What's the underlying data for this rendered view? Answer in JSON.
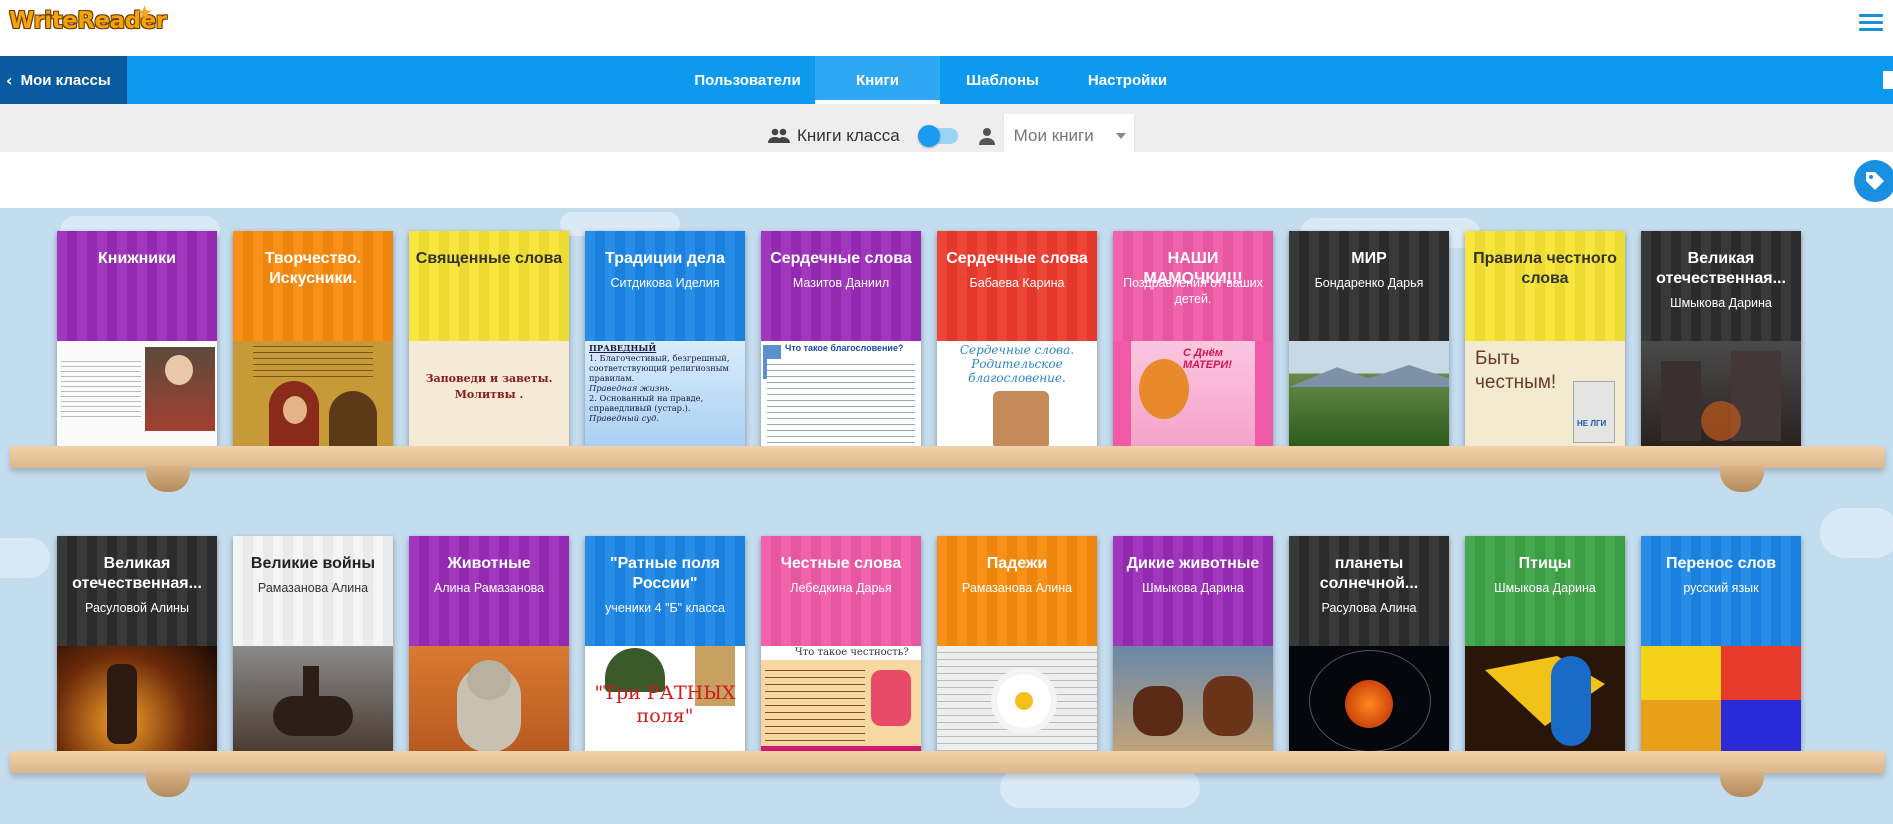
{
  "app": {
    "logo": "WriteReader",
    "logo_star": "★"
  },
  "nav": {
    "back_label": "Мои классы",
    "tabs": [
      {
        "label": "Пользователи",
        "active": false
      },
      {
        "label": "Книги",
        "active": true
      },
      {
        "label": "Шаблоны",
        "active": false
      },
      {
        "label": "Настройки",
        "active": false
      }
    ]
  },
  "filters": {
    "class_books_label": "Книги класса",
    "toggle_on": false,
    "my_books_select": "Мои книги"
  },
  "colors": {
    "nav_blue": "#0d9aee",
    "back_blue": "#0a5aa0",
    "accent": "#1a8fe0"
  },
  "shelves": [
    {
      "books": [
        {
          "title": "Книжники",
          "author": "",
          "color": "#9a2bb8",
          "pic": "portrait-page"
        },
        {
          "title": "Творчество. Искусники.",
          "author": "",
          "color": "#f88a0c",
          "pic": "icon-painting"
        },
        {
          "title": "Священные слова",
          "author": "",
          "color": "#f6e533",
          "pic": "parchment-text",
          "style": "yellow"
        },
        {
          "title": "Традиции дела",
          "author": "Ситдикова Иделия",
          "color": "#1a86e6",
          "pic": "text-sky"
        },
        {
          "title": "Сердечные слова",
          "author": "Мазитов Даниил",
          "color": "#9a2bb8",
          "pic": "text-list"
        },
        {
          "title": "Сердечные слова",
          "author": "Бабаева Карина",
          "color": "#ec3a2d",
          "pic": "family-photo"
        },
        {
          "title": "НАШИ МАМОЧКИ!!!",
          "author": "Поздравления от ваших детей.",
          "color": "#f05aa6",
          "pic": "mothers-day-card"
        },
        {
          "title": "МИР",
          "author": "Бондаренко Дарья",
          "color": "#2d2d2d",
          "pic": "forest"
        },
        {
          "title": "Правила честного слова",
          "author": "",
          "color": "#f6e533",
          "pic": "honest-card",
          "style": "yellow"
        },
        {
          "title": "Великая отечественная...",
          "author": "Шмыкова Дарина",
          "color": "#2d2d2d",
          "pic": "ruins"
        }
      ]
    },
    {
      "books": [
        {
          "title": "Великая отечественная...",
          "author": "Расуловой Алины",
          "color": "#2d2d2d",
          "pic": "soldier-fire"
        },
        {
          "title": "Великие войны",
          "author": "Рамазанова Алина",
          "color": "#f4f4f4",
          "pic": "horseman",
          "style": "light"
        },
        {
          "title": "Животные",
          "author": "Алина Рамазанова",
          "color": "#9a2bb8",
          "pic": "cat"
        },
        {
          "title": "\"Ратные поля России\"",
          "author": "ученики 4 \"Б\" класса",
          "color": "#1a86e6",
          "pic": "helmet-text"
        },
        {
          "title": "Честные слова",
          "author": "Лебедкина Дарья",
          "color": "#f05aa6",
          "pic": "honesty-text"
        },
        {
          "title": "Падежи",
          "author": "Рамазанова Алина",
          "color": "#f88a0c",
          "pic": "daisy"
        },
        {
          "title": "Дикие животные",
          "author": "Шмыкова Дарина",
          "color": "#9a2bb8",
          "pic": "horses"
        },
        {
          "title": "планеты солнечной...",
          "author": "Расулова Алина",
          "color": "#2d2d2d",
          "pic": "solar-system"
        },
        {
          "title": "Птицы",
          "author": "Шмыкова Дарина",
          "color": "#3da346",
          "pic": "parrot"
        },
        {
          "title": "Перенос слов",
          "author": "русский язык",
          "color": "#1a86e6",
          "pic": "letters-abc"
        }
      ]
    }
  ],
  "book_pictures_text": {
    "parchment": "Заповеди и заветы. Молитвы .",
    "text_sky_head": "ПРАВЕДНЫЙ",
    "text_sky_body": "1. Благочестивый, безгрешный, соответствующий религиозным правилам.",
    "text_sky_italic": "Праведная жизнь.",
    "text_sky_body2": "2. Основанный на правде, справедливый (устар.).",
    "text_sky_italic2": "Праведный суд.",
    "text_list_head": "Что такое благословение?",
    "family_text": "Сердечные слова. Родительское благословение.",
    "mothers_card": "С Днём МАТЕРИ!",
    "honest_card": "Быть честным!",
    "honest_card_small": "НЕ ЛГИ",
    "helmet_text": "\"Три РАТНЫХ поля\"",
    "honesty_head": "Что такое честность?"
  }
}
